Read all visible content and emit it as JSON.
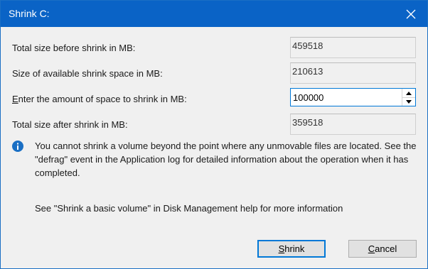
{
  "window": {
    "title": "Shrink C:"
  },
  "fields": {
    "total_before": {
      "label": "Total size before shrink in MB:",
      "value": "459518"
    },
    "available_shrink": {
      "label": "Size of available shrink space in MB:",
      "value": "210613"
    },
    "shrink_amount": {
      "mnemonic": "E",
      "label_rest": "nter the amount of space to shrink in MB:",
      "value": "100000"
    },
    "total_after": {
      "label": "Total size after shrink in MB:",
      "value": "359518"
    }
  },
  "info": {
    "icon": "info-icon",
    "text": "You cannot shrink a volume beyond the point where any unmovable files are located. See the \"defrag\" event in the Application log for detailed information about the operation when it has completed.",
    "help_text": "See \"Shrink a basic volume\" in Disk Management help for more information"
  },
  "buttons": {
    "shrink": {
      "mnemonic": "S",
      "label_rest": "hrink"
    },
    "cancel": {
      "mnemonic": "C",
      "label_rest": "ancel"
    }
  },
  "colors": {
    "titlebar": "#0a63c6",
    "focus_border": "#0078d7",
    "info_icon": "#1a6fc4",
    "dialog_bg": "#f0f0f0"
  }
}
